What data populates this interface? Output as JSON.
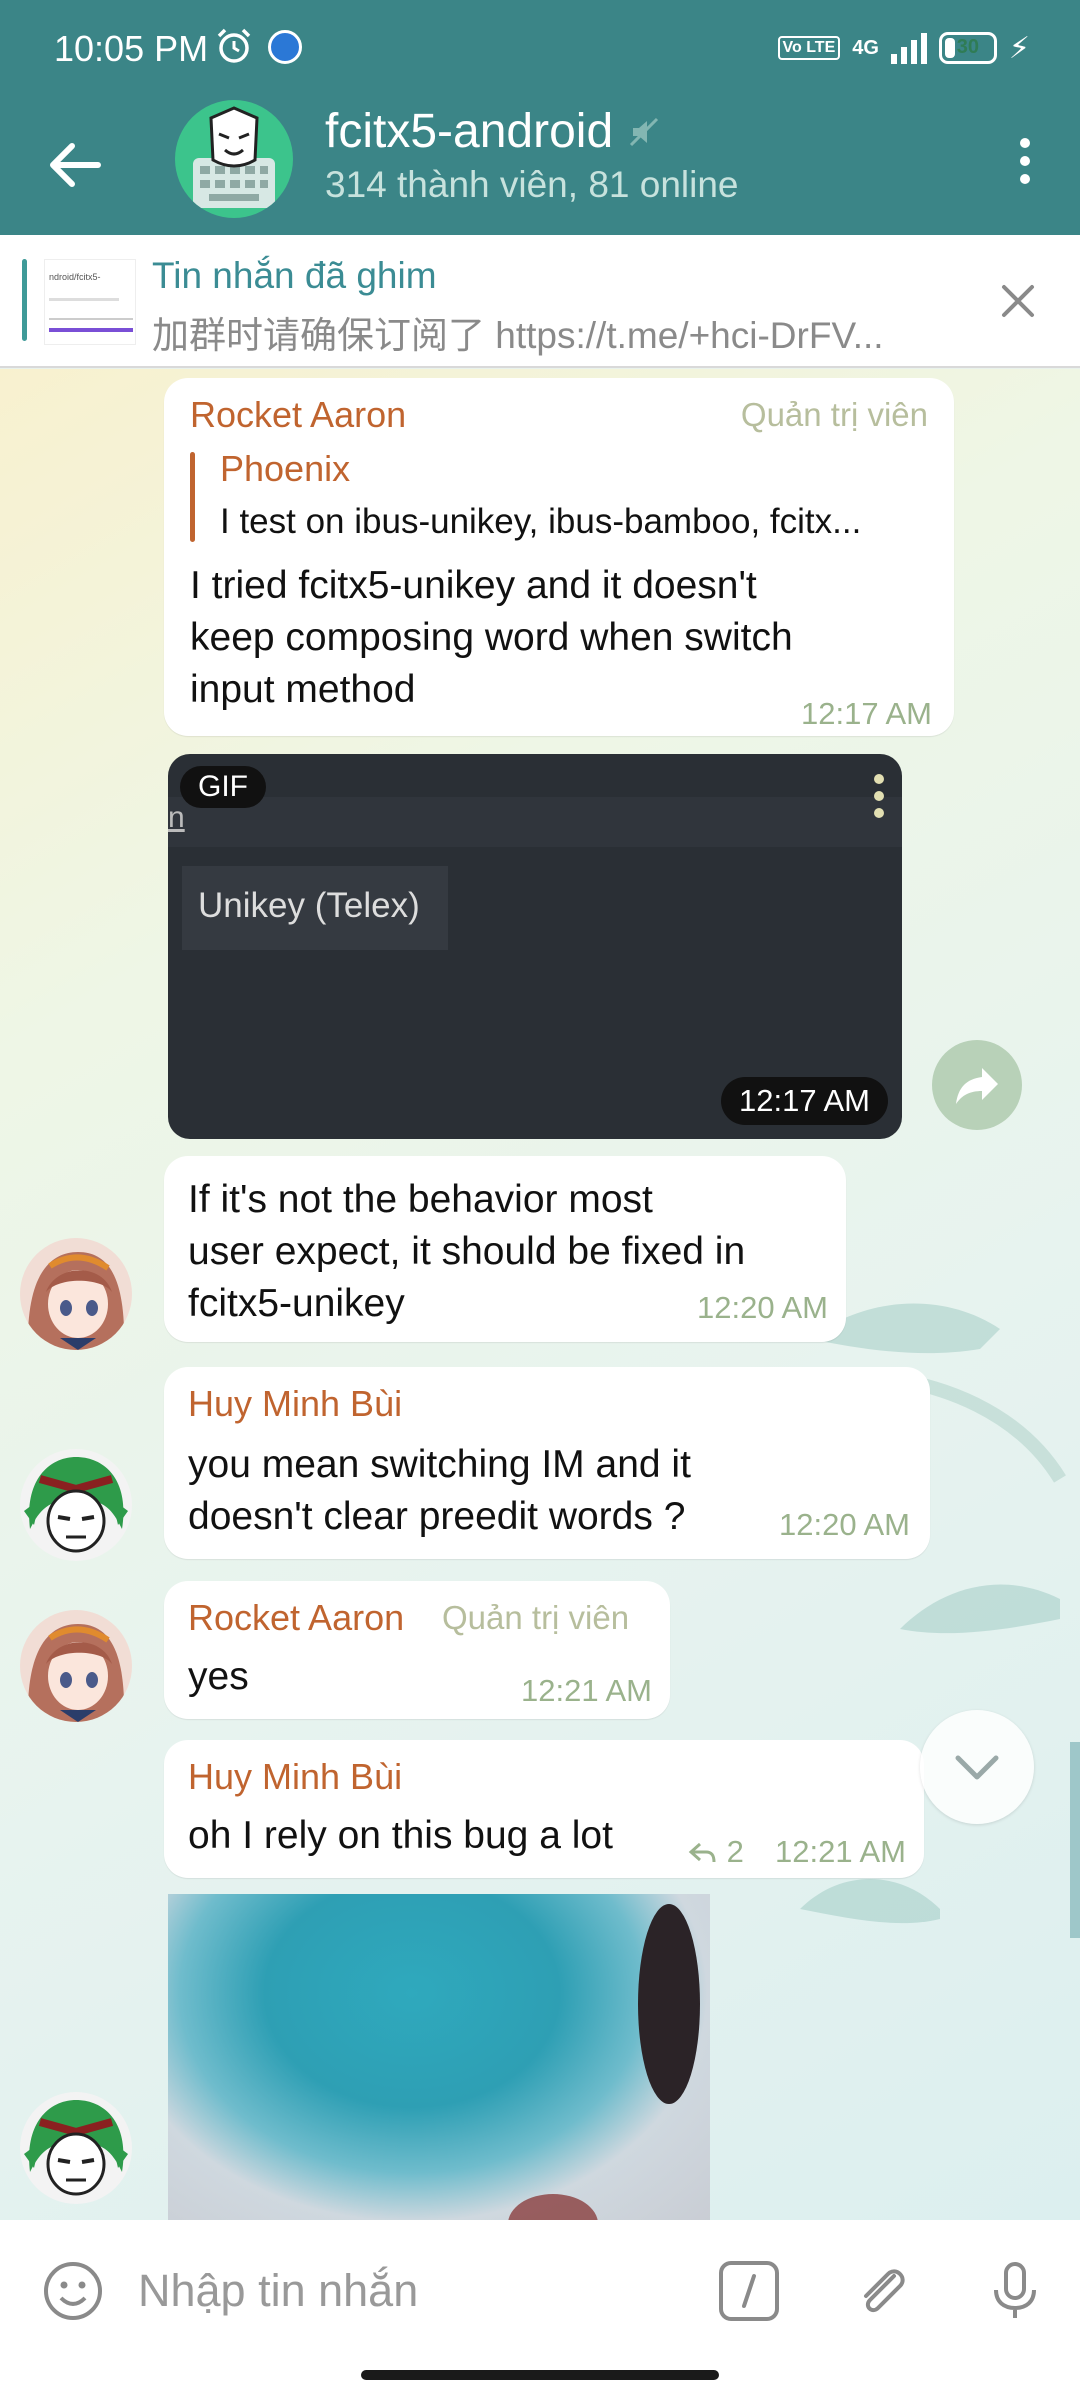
{
  "status_bar": {
    "time": "10:05 PM",
    "volte": "Vo LTE",
    "network": "4G",
    "battery": "30",
    "battery_level": 30
  },
  "header": {
    "title": "fcitx5-android",
    "subtitle": "314 thành viên, 81 online",
    "bg_color": "#3b8587"
  },
  "pinned": {
    "title": "Tin nhắn đã ghim",
    "text": "加群时请确保订阅了 https://t.me/+hci-DrFV...",
    "thumb_text": "ndroid/fcitx5-"
  },
  "messages": [
    {
      "sender": "Rocket Aaron",
      "role": "Quản trị viên",
      "reply_to": {
        "name": "Phoenix",
        "text": "I test on ibus-unikey, ibus-bamboo, fcitx..."
      },
      "lines": [
        "I tried fcitx5-unikey and it doesn't",
        "keep composing word when switch",
        "input method"
      ],
      "time": "12:17 AM"
    },
    {
      "type": "gif",
      "badge": "GIF",
      "strip_text": "n",
      "overlay_text": "Unikey (Telex)",
      "time": "12:17 AM"
    },
    {
      "lines": [
        "If it's not the behavior most",
        "user expect, it should be fixed in",
        "fcitx5-unikey"
      ],
      "time": "12:20 AM"
    },
    {
      "sender": "Huy Minh Bùi",
      "lines": [
        "you mean switching IM and it",
        "doesn't clear preedit words ?"
      ],
      "time": "12:20 AM"
    },
    {
      "sender": "Rocket Aaron",
      "role": "Quản trị viên",
      "lines": [
        "yes"
      ],
      "time": "12:21 AM"
    },
    {
      "sender": "Huy Minh Bùi",
      "lines": [
        "oh I rely on this bug a lot"
      ],
      "replies": "2",
      "time": "12:21 AM"
    }
  ],
  "input": {
    "placeholder": "Nhập tin nhắn",
    "command_icon": "/"
  },
  "colors": {
    "accent": "#3b8587",
    "sender": "#c0642f",
    "time": "#9ab28c",
    "role": "#b7be9d"
  },
  "icons": [
    "back-arrow-icon",
    "mute-icon",
    "more-vert-icon",
    "close-icon",
    "share-icon",
    "chevron-down-icon",
    "emoji-icon",
    "slash-command-icon",
    "attach-icon",
    "mic-icon",
    "reply-icon"
  ]
}
